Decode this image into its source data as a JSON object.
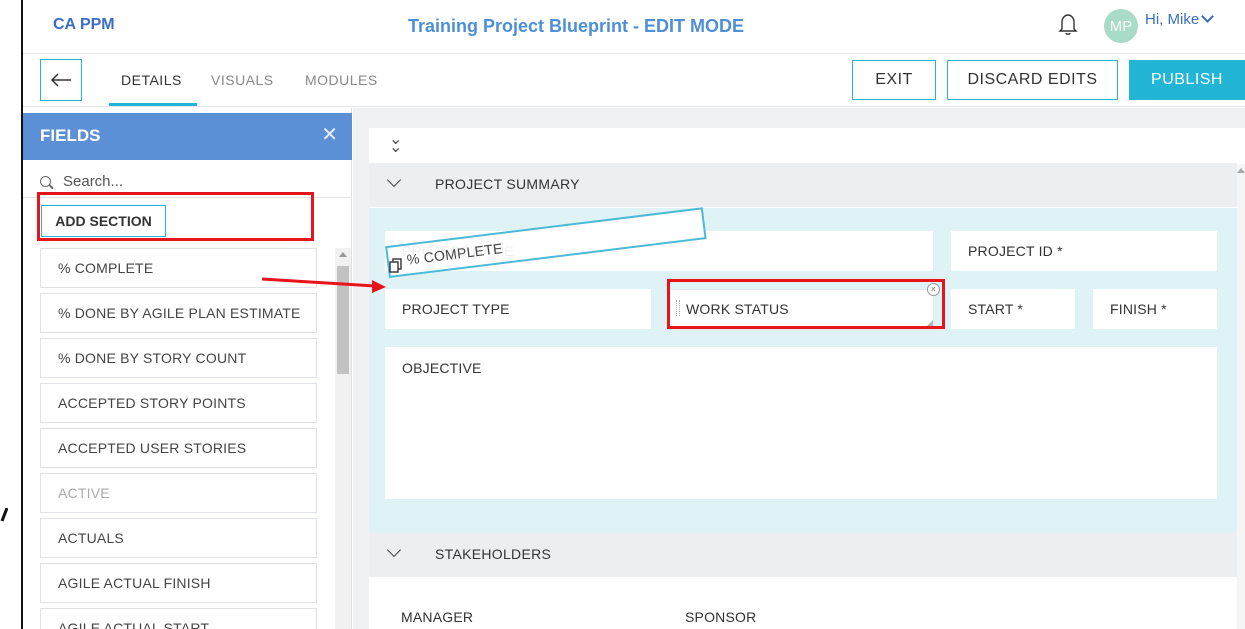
{
  "header": {
    "brand": "CA PPM",
    "title": "Training Project Blueprint - EDIT MODE",
    "avatar_initials": "MP",
    "greeting": "Hi, Mike"
  },
  "nav": {
    "tabs": [
      {
        "label": "DETAILS",
        "active": true
      },
      {
        "label": "VISUALS",
        "active": false
      },
      {
        "label": "MODULES",
        "active": false
      }
    ],
    "exit_label": "EXIT",
    "discard_label": "DISCARD EDITS",
    "publish_label": "PUBLISH"
  },
  "fields_panel": {
    "title": "FIELDS",
    "search_placeholder": "Search...",
    "add_section_label": "ADD SECTION",
    "items": [
      {
        "label": "% COMPLETE",
        "enabled": true
      },
      {
        "label": "% DONE BY AGILE PLAN ESTIMATE",
        "enabled": true
      },
      {
        "label": "% DONE BY STORY COUNT",
        "enabled": true
      },
      {
        "label": "ACCEPTED STORY POINTS",
        "enabled": true
      },
      {
        "label": "ACCEPTED USER STORIES",
        "enabled": true
      },
      {
        "label": "ACTIVE",
        "enabled": false
      },
      {
        "label": "ACTUALS",
        "enabled": true
      },
      {
        "label": "AGILE ACTUAL FINISH",
        "enabled": true
      },
      {
        "label": "AGILE ACTUAL START",
        "enabled": true
      }
    ]
  },
  "canvas": {
    "sections": [
      {
        "label": "PROJECT SUMMARY",
        "fields": {
          "project_name": "PROJECT NAME",
          "project_id": "PROJECT ID *",
          "project_type": "PROJECT TYPE",
          "work_status": "WORK STATUS",
          "start": "START *",
          "finish": "FINISH *",
          "objective": "OBJECTIVE"
        }
      },
      {
        "label": "STAKEHOLDERS",
        "fields": {
          "manager": "MANAGER",
          "sponsor": "SPONSOR"
        }
      }
    ],
    "dragging_field": "% COMPLETE"
  },
  "colors": {
    "accent": "#22b5d6",
    "panel_header": "#5b8fd6",
    "highlight": "#e8141b",
    "section_body": "#dff3f7"
  }
}
